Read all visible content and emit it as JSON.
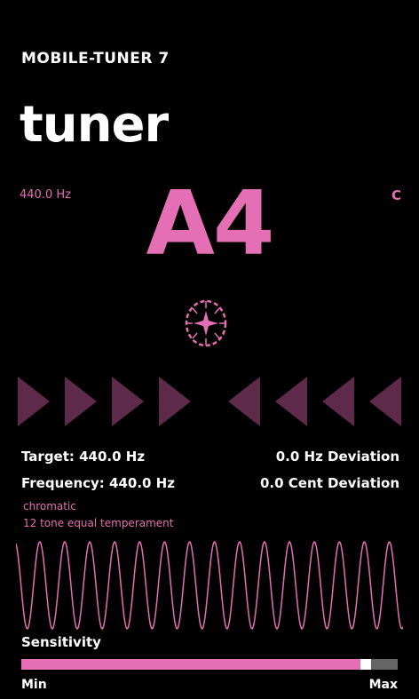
{
  "app": {
    "title": "MOBILE-TUNER 7"
  },
  "page": {
    "title": "tuner"
  },
  "reference": {
    "frequency": "440.0 Hz",
    "toggle_label": "C"
  },
  "note": {
    "name": "A4"
  },
  "icons": {
    "status": "tuning-wheel-icon"
  },
  "arrows": {
    "left_count": 4,
    "right_count": 4,
    "color": "#5e2a4a"
  },
  "readout": {
    "target": "Target: 440.0 Hz",
    "frequency": "Frequency: 440.0 Hz",
    "hz_deviation": "0.0 Hz Deviation",
    "cent_deviation": "0.0 Cent Deviation"
  },
  "tuning": {
    "mode": "chromatic",
    "temperament": "12 tone equal temperament"
  },
  "sensitivity": {
    "label": "Sensitivity",
    "min_label": "Min",
    "max_label": "Max",
    "level": 0.93
  },
  "colors": {
    "accent": "#e46fb4",
    "background": "#000000"
  }
}
